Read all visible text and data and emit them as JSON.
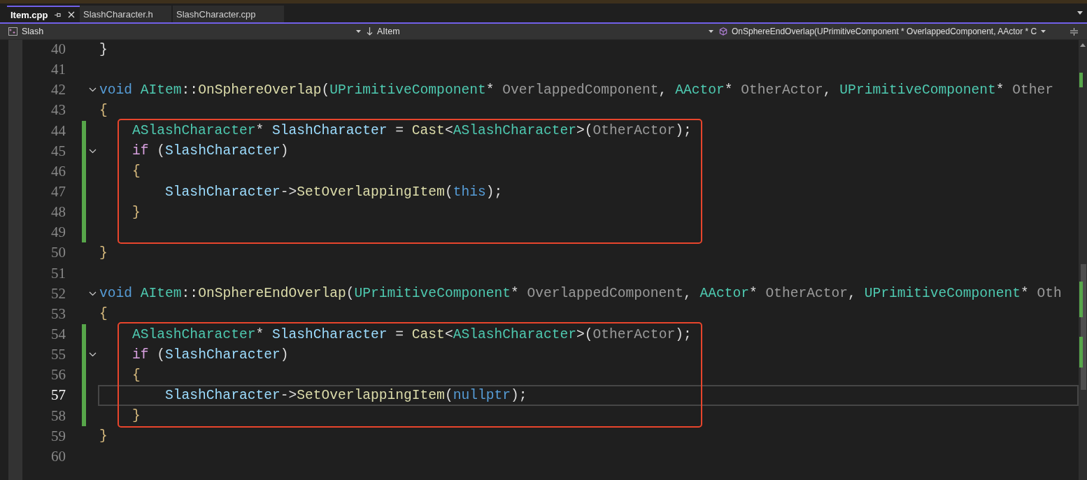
{
  "tabs": [
    {
      "label": "Item.cpp",
      "selected": true,
      "pinned": true,
      "closable": true
    },
    {
      "label": "SlashCharacter.h",
      "selected": false,
      "pinned": false,
      "closable": false
    },
    {
      "label": "SlashCharacter.cpp",
      "selected": false,
      "pinned": false,
      "closable": false
    }
  ],
  "nav_bar": {
    "project": "Slash",
    "scope": "AItem",
    "member": "OnSphereEndOverlap(UPrimitiveComponent * OverlappedComponent, AActor * C"
  },
  "blocks": [
    {
      "boxed": false,
      "lines": [
        {
          "number": "40",
          "changed": false,
          "current": false,
          "foldable": false,
          "tokens": [
            {
              "text": "}",
              "kind": "plain"
            }
          ]
        },
        {
          "number": "41",
          "changed": false,
          "current": false,
          "foldable": false
        },
        {
          "number": "42",
          "changed": false,
          "current": false,
          "foldable": true,
          "tokens": [
            {
              "text": "void ",
              "kind": "keyword"
            },
            {
              "text": "AItem",
              "kind": "type"
            },
            {
              "text": "::",
              "kind": "plain"
            },
            {
              "text": "OnSphereOverlap",
              "kind": "function"
            },
            {
              "text": "(",
              "kind": "plain"
            },
            {
              "text": "UPrimitiveComponent",
              "kind": "type"
            },
            {
              "text": "* ",
              "kind": "plain"
            },
            {
              "text": "OverlappedComponent",
              "kind": "param"
            },
            {
              "text": ", ",
              "kind": "plain"
            },
            {
              "text": "AActor",
              "kind": "type"
            },
            {
              "text": "* ",
              "kind": "plain"
            },
            {
              "text": "OtherActor",
              "kind": "param"
            },
            {
              "text": ", ",
              "kind": "plain"
            },
            {
              "text": "UPrimitiveComponent",
              "kind": "type"
            },
            {
              "text": "* ",
              "kind": "plain"
            },
            {
              "text": "Other",
              "kind": "param"
            }
          ]
        },
        {
          "number": "43",
          "changed": false,
          "current": false,
          "foldable": false,
          "tokens": [
            {
              "text": "{",
              "kind": "brace"
            }
          ]
        }
      ]
    },
    {
      "boxed": true,
      "lines": [
        {
          "number": "44",
          "changed": true,
          "current": false,
          "foldable": false,
          "tokens": [
            {
              "text": "    ASlashCharacter",
              "kind": "type"
            },
            {
              "text": "* ",
              "kind": "plain"
            },
            {
              "text": "SlashCharacter",
              "kind": "variable"
            },
            {
              "text": " = ",
              "kind": "plain"
            },
            {
              "text": "Cast",
              "kind": "function"
            },
            {
              "text": "<",
              "kind": "plain"
            },
            {
              "text": "ASlashCharacter",
              "kind": "type"
            },
            {
              "text": ">(",
              "kind": "plain"
            },
            {
              "text": "OtherActor",
              "kind": "param"
            },
            {
              "text": ");",
              "kind": "plain"
            }
          ]
        },
        {
          "number": "45",
          "changed": true,
          "current": false,
          "foldable": true,
          "tokens": [
            {
              "text": "    if",
              "kind": "control"
            },
            {
              "text": " (",
              "kind": "plain"
            },
            {
              "text": "SlashCharacter",
              "kind": "variable"
            },
            {
              "text": ")",
              "kind": "plain"
            }
          ]
        },
        {
          "number": "46",
          "changed": true,
          "current": false,
          "foldable": false,
          "tokens": [
            {
              "text": "    {",
              "kind": "brace"
            }
          ]
        },
        {
          "number": "47",
          "changed": true,
          "current": false,
          "foldable": false,
          "tokens": [
            {
              "text": "        SlashCharacter",
              "kind": "variable"
            },
            {
              "text": "->",
              "kind": "plain"
            },
            {
              "text": "SetOverlappingItem",
              "kind": "function"
            },
            {
              "text": "(",
              "kind": "plain"
            },
            {
              "text": "this",
              "kind": "keyword"
            },
            {
              "text": ");",
              "kind": "plain"
            }
          ]
        },
        {
          "number": "48",
          "changed": true,
          "current": false,
          "foldable": false,
          "tokens": [
            {
              "text": "    }",
              "kind": "brace"
            }
          ]
        },
        {
          "number": "49",
          "changed": true,
          "current": false,
          "foldable": false
        }
      ]
    },
    {
      "boxed": false,
      "lines": [
        {
          "number": "50",
          "changed": false,
          "current": false,
          "foldable": false,
          "tokens": [
            {
              "text": "}",
              "kind": "brace"
            }
          ]
        },
        {
          "number": "51",
          "changed": false,
          "current": false,
          "foldable": false
        },
        {
          "number": "52",
          "changed": false,
          "current": false,
          "foldable": true,
          "tokens": [
            {
              "text": "void ",
              "kind": "keyword"
            },
            {
              "text": "AItem",
              "kind": "type"
            },
            {
              "text": "::",
              "kind": "plain"
            },
            {
              "text": "OnSphereEndOverlap",
              "kind": "function"
            },
            {
              "text": "(",
              "kind": "plain"
            },
            {
              "text": "UPrimitiveComponent",
              "kind": "type"
            },
            {
              "text": "* ",
              "kind": "plain"
            },
            {
              "text": "OverlappedComponent",
              "kind": "param"
            },
            {
              "text": ", ",
              "kind": "plain"
            },
            {
              "text": "AActor",
              "kind": "type"
            },
            {
              "text": "* ",
              "kind": "plain"
            },
            {
              "text": "OtherActor",
              "kind": "param"
            },
            {
              "text": ", ",
              "kind": "plain"
            },
            {
              "text": "UPrimitiveComponent",
              "kind": "type"
            },
            {
              "text": "* ",
              "kind": "plain"
            },
            {
              "text": "Oth",
              "kind": "param"
            }
          ]
        },
        {
          "number": "53",
          "changed": false,
          "current": false,
          "foldable": false,
          "tokens": [
            {
              "text": "{",
              "kind": "brace"
            }
          ]
        }
      ]
    },
    {
      "boxed": true,
      "lines": [
        {
          "number": "54",
          "changed": true,
          "current": false,
          "foldable": false,
          "tokens": [
            {
              "text": "    ASlashCharacter",
              "kind": "type"
            },
            {
              "text": "* ",
              "kind": "plain"
            },
            {
              "text": "SlashCharacter",
              "kind": "variable"
            },
            {
              "text": " = ",
              "kind": "plain"
            },
            {
              "text": "Cast",
              "kind": "function"
            },
            {
              "text": "<",
              "kind": "plain"
            },
            {
              "text": "ASlashCharacter",
              "kind": "type"
            },
            {
              "text": ">(",
              "kind": "plain"
            },
            {
              "text": "OtherActor",
              "kind": "param"
            },
            {
              "text": ");",
              "kind": "plain"
            }
          ]
        },
        {
          "number": "55",
          "changed": true,
          "current": false,
          "foldable": true,
          "tokens": [
            {
              "text": "    if",
              "kind": "control"
            },
            {
              "text": " (",
              "kind": "plain"
            },
            {
              "text": "SlashCharacter",
              "kind": "variable"
            },
            {
              "text": ")",
              "kind": "plain"
            }
          ]
        },
        {
          "number": "56",
          "changed": true,
          "current": false,
          "foldable": false,
          "tokens": [
            {
              "text": "    {",
              "kind": "brace"
            }
          ]
        },
        {
          "number": "57",
          "changed": true,
          "current": true,
          "foldable": false,
          "tokens": [
            {
              "text": "        SlashCharacter",
              "kind": "variable"
            },
            {
              "text": "->",
              "kind": "plain"
            },
            {
              "text": "SetOverlappingItem",
              "kind": "function"
            },
            {
              "text": "(",
              "kind": "plain"
            },
            {
              "text": "nullptr",
              "kind": "keyword"
            },
            {
              "text": ");",
              "kind": "plain"
            }
          ]
        },
        {
          "number": "58",
          "changed": true,
          "current": false,
          "foldable": false,
          "tokens": [
            {
              "text": "    }",
              "kind": "brace"
            }
          ]
        }
      ]
    },
    {
      "boxed": false,
      "lines": [
        {
          "number": "59",
          "changed": false,
          "current": false,
          "foldable": false,
          "tokens": [
            {
              "text": "}",
              "kind": "brace"
            }
          ]
        },
        {
          "number": "60",
          "changed": false,
          "current": false,
          "foldable": false
        }
      ]
    }
  ]
}
